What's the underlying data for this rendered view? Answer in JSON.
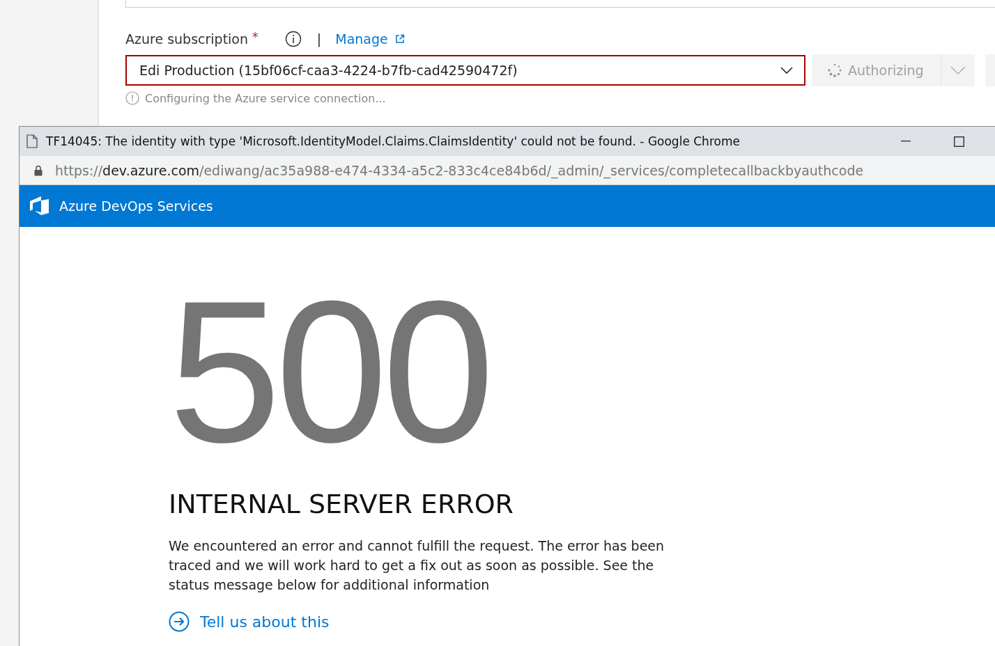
{
  "form": {
    "label": "Azure subscription",
    "required_mark": "*",
    "separator": "|",
    "manage_link": "Manage",
    "subscription": {
      "value": "Edi Production (15bf06cf-caa3-4224-b7fb-cad42590472f)",
      "error": true
    },
    "authorize_button": {
      "label": "Authorizing",
      "busy": true,
      "disabled": true
    },
    "status_message": "Configuring the Azure service connection..."
  },
  "popup": {
    "title": "TF14045: The identity with type 'Microsoft.IdentityModel.Claims.ClaimsIdentity' could not be found. - Google Chrome",
    "url": {
      "scheme": "https://",
      "host": "dev.azure.com",
      "path": "/ediwang/ac35a988-e474-4334-a5c2-833c4ce84b6d/_admin/_services/completecallbackbyauthcode"
    },
    "brand": "Azure DevOps Services",
    "error_code": "500",
    "error_title": "INTERNAL SERVER ERROR",
    "error_message": "We encountered an error and cannot fulfill the request. The error has been traced and we will work hard to get a fix out as soon as possible. See the status message below for additional information",
    "feedback_link": "Tell us about this"
  }
}
